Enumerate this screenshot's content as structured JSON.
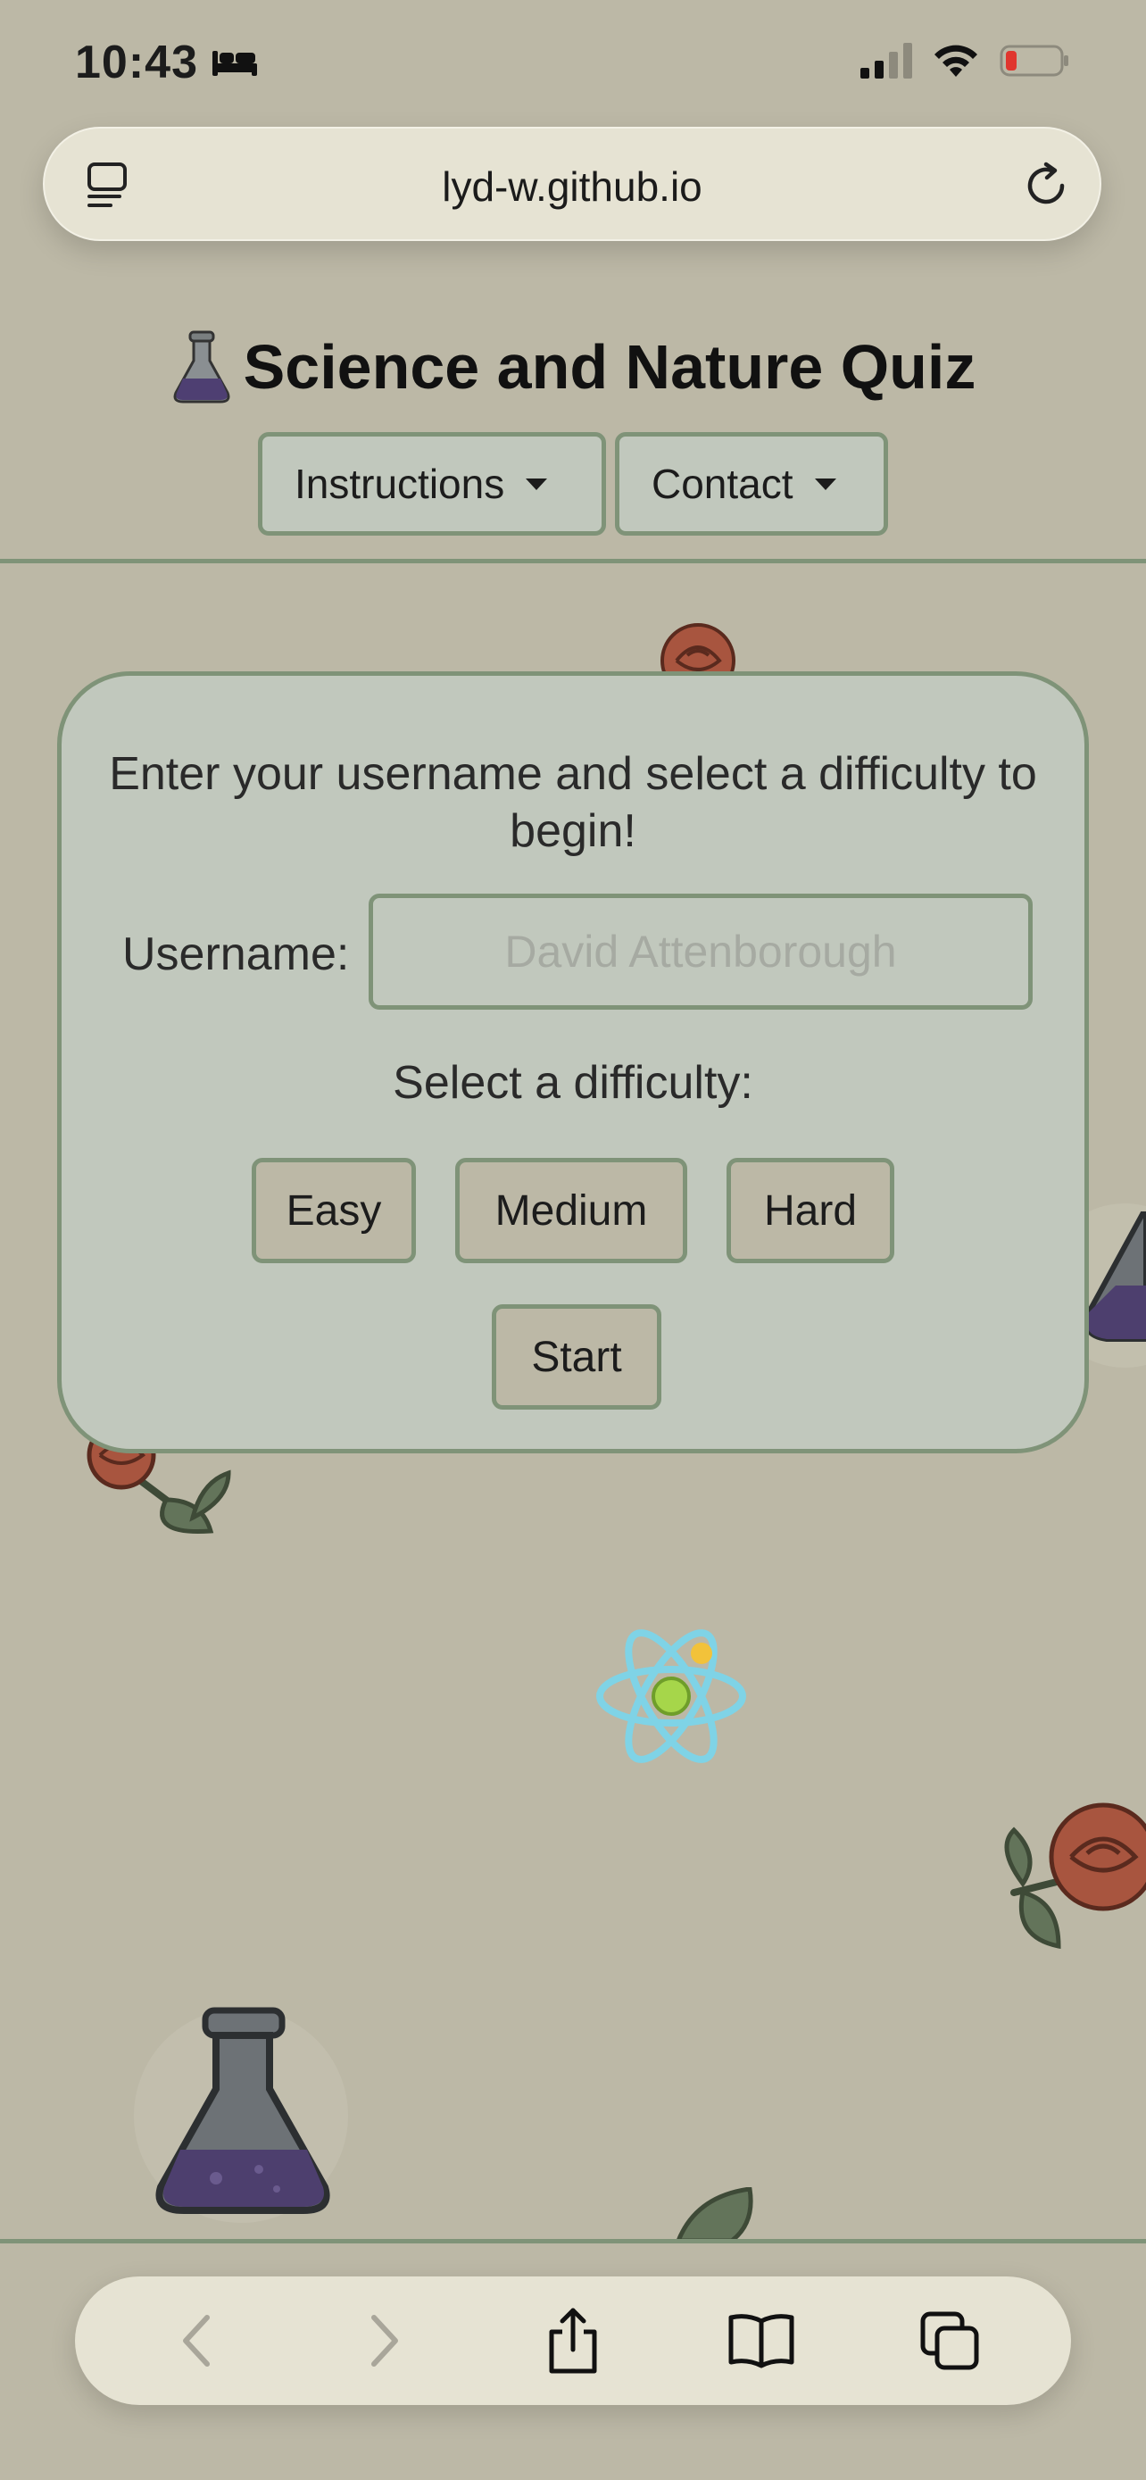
{
  "status_bar": {
    "time": "10:43",
    "sleep_icon": "bed-icon",
    "signal_icon": "cellular-signal-icon",
    "wifi_icon": "wifi-icon",
    "battery_icon": "battery-low-icon"
  },
  "browser": {
    "url": "lyd-w.github.io",
    "reader_icon": "reader-mode-icon",
    "reload_icon": "reload-icon"
  },
  "header": {
    "title_icon": "flask-icon",
    "title": "Science and Nature Quiz",
    "nav": {
      "instructions_label": "Instructions",
      "contact_label": "Contact"
    }
  },
  "quiz_card": {
    "heading": "Enter your username and select a difficulty to begin!",
    "username_label": "Username:",
    "username_placeholder": "David Attenborough",
    "username_value": "",
    "difficulty_label": "Select a difficulty:",
    "difficulties": [
      "Easy",
      "Medium",
      "Hard"
    ],
    "start_label": "Start"
  },
  "toolbar": {
    "back_icon": "back-arrow-icon",
    "forward_icon": "forward-arrow-icon",
    "share_icon": "share-icon",
    "bookmarks_icon": "bookmarks-book-icon",
    "tabs_icon": "tabs-icon"
  },
  "colors": {
    "background": "#bcb8a6",
    "card": "#c1c8bd",
    "accent_border": "#7f9378",
    "browser_chrome": "#e6e3d3"
  }
}
